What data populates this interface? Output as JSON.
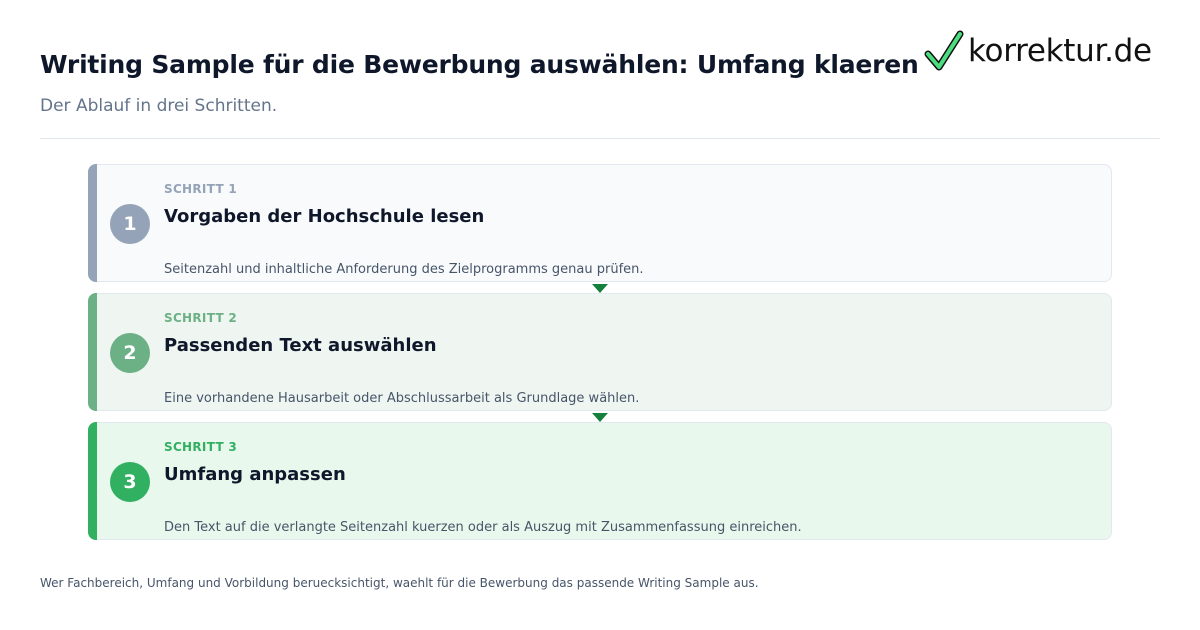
{
  "header": {
    "title": "Writing Sample für die Bewerbung auswählen: Umfang klaeren",
    "subtitle": "Der Ablauf in drei Schritten."
  },
  "logo": {
    "text": "korrektur.de",
    "icon": "checkmark-icon",
    "icon_color": "#22c55e"
  },
  "steps": [
    {
      "number": "1",
      "kicker": "SCHRITT 1",
      "title": "Vorgaben der Hochschule lesen",
      "description": "Seitenzahl und inhaltliche Anforderung des Zielprogramms genau prüfen.",
      "accent": "#94a3b8",
      "background": "#f8fafc"
    },
    {
      "number": "2",
      "kicker": "SCHRITT 2",
      "title": "Passenden Text auswählen",
      "description": "Eine vorhandene Hausarbeit oder Abschlussarbeit als Grundlage wählen.",
      "accent": "#6bb185",
      "background": "#eff5f0"
    },
    {
      "number": "3",
      "kicker": "SCHRITT 3",
      "title": "Umfang anpassen",
      "description": "Den Text auf die verlangte Seitenzahl kuerzen oder als Auszug mit Zusammenfassung einreichen.",
      "accent": "#31b061",
      "background": "#e9f8ec"
    }
  ],
  "connector_color": "#15803d",
  "footer": "Wer Fachbereich, Umfang und Vorbildung beruecksichtigt, waehlt für die Bewerbung das passende Writing Sample aus."
}
